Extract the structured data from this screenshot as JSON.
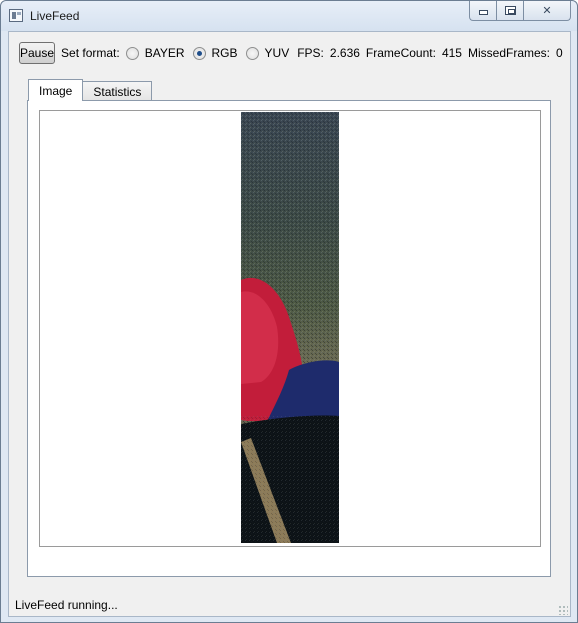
{
  "window": {
    "title": "LiveFeed",
    "app_icon": "window-app-icon",
    "controls": {
      "minimize_icon": "minimize-icon",
      "maximize_icon": "maximize-icon",
      "close_glyph": "✕"
    }
  },
  "toolbar": {
    "pause_label": "Pause",
    "format_label": "Set format:",
    "formats": [
      {
        "label": "BAYER",
        "checked": false
      },
      {
        "label": "RGB",
        "checked": true
      },
      {
        "label": "YUV",
        "checked": false
      }
    ],
    "fps_label": "FPS:",
    "fps_value": "2.636",
    "framecount_label": "FrameCount:",
    "framecount_value": "415",
    "missed_label": "MissedFrames:",
    "missed_value": "0"
  },
  "tabs": [
    {
      "label": "Image",
      "active": true
    },
    {
      "label": "Statistics",
      "active": false
    }
  ],
  "image": {
    "description_icon": "camera-frame-image",
    "colors": {
      "top": "#3a4a52",
      "middle": "#4b5744",
      "red": "#c8203a",
      "blue": "#1c2a6a",
      "dark": "#0d1418",
      "tan": "#8d7b58"
    }
  },
  "status": {
    "text": "LiveFeed running..."
  }
}
